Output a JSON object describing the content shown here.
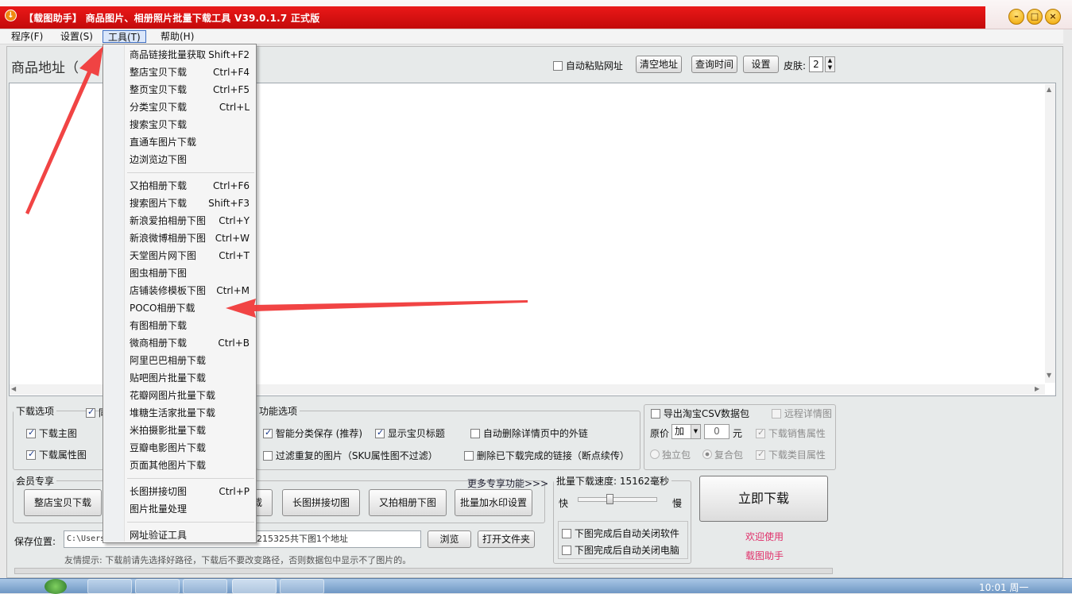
{
  "window": {
    "title": "【载图助手】 商品图片、相册照片批量下载工具 V39.0.1.7 正式版"
  },
  "menubar": [
    "程序(F)",
    "设置(S)",
    "工具(T)",
    "帮助(H)"
  ],
  "top": {
    "goods_label": "商品地址（",
    "auto_paste": "自动粘贴网址",
    "clear": "清空地址",
    "query_time": "查询时间",
    "settings": "设置",
    "skin_label": "皮肤:",
    "skin_value": "2"
  },
  "dropdown": {
    "group1": [
      {
        "label": "商品链接批量获取",
        "shortcut": "Shift+F2"
      },
      {
        "label": "整店宝贝下载",
        "shortcut": "Ctrl+F4"
      },
      {
        "label": "整页宝贝下载",
        "shortcut": "Ctrl+F5"
      },
      {
        "label": "分类宝贝下载",
        "shortcut": "Ctrl+L"
      },
      {
        "label": "搜索宝贝下载",
        "shortcut": ""
      },
      {
        "label": "直通车图片下载",
        "shortcut": ""
      },
      {
        "label": "边浏览边下图",
        "shortcut": ""
      }
    ],
    "group2": [
      {
        "label": "又拍相册下载",
        "shortcut": "Ctrl+F6"
      },
      {
        "label": "搜索图片下载",
        "shortcut": "Shift+F3"
      },
      {
        "label": "新浪爱拍相册下图",
        "shortcut": "Ctrl+Y"
      },
      {
        "label": "新浪微博相册下图",
        "shortcut": "Ctrl+W"
      },
      {
        "label": "天堂图片网下图",
        "shortcut": "Ctrl+T"
      },
      {
        "label": "图虫相册下图",
        "shortcut": ""
      },
      {
        "label": "店铺装修模板下图",
        "shortcut": "Ctrl+M"
      },
      {
        "label": "POCO相册下载",
        "shortcut": ""
      },
      {
        "label": "有图相册下载",
        "shortcut": ""
      },
      {
        "label": "微商相册下载",
        "shortcut": "Ctrl+B"
      },
      {
        "label": "阿里巴巴相册下载",
        "shortcut": ""
      },
      {
        "label": "贴吧图片批量下载",
        "shortcut": ""
      },
      {
        "label": "花瓣网图片批量下载",
        "shortcut": ""
      },
      {
        "label": "堆糖生活家批量下载",
        "shortcut": ""
      },
      {
        "label": "米拍摄影批量下载",
        "shortcut": ""
      },
      {
        "label": "豆瓣电影图片下载",
        "shortcut": ""
      },
      {
        "label": "页面其他图片下载",
        "shortcut": ""
      }
    ],
    "group3": [
      {
        "label": "长图拼接切图",
        "shortcut": "Ctrl+P"
      },
      {
        "label": "图片批量处理",
        "shortcut": ""
      }
    ],
    "group4": [
      {
        "label": "网址验证工具",
        "shortcut": ""
      }
    ]
  },
  "download_options": {
    "legend": "下载选项",
    "partial_top": "同",
    "main_image": "下载主图",
    "attr_image": "下载属性图"
  },
  "function_options": {
    "legend": "功能选项",
    "smart_save": "智能分类保存 (推荐)",
    "show_title": "显示宝贝标题",
    "auto_delete_links": "自动删除详情页中的外链",
    "filter_dup": "过滤重复的图片（SKU属性图不过滤）",
    "delete_done": "删除已下载完成的链接（断点续传）"
  },
  "taobao": {
    "export_csv": "导出淘宝CSV数据包",
    "remote_detail": "远程详情图",
    "price_label": "原价",
    "op_value": "加",
    "amount_value": "0",
    "unit": "元",
    "sales_attr": "下载销售属性",
    "single_pkg": "独立包",
    "combined_pkg": "复合包",
    "category_attr": "下载类目属性"
  },
  "member": {
    "legend": "会员专享",
    "more": "更多专享功能>>>",
    "buttons": [
      "整店宝贝下载",
      "载",
      "长图拼接切图",
      "又拍相册下图",
      "批量加水印设置"
    ]
  },
  "speed": {
    "legend": "批量下载速度: 15162毫秒",
    "fast": "快",
    "slow": "慢",
    "slider_fraction": 0.4,
    "close_software": "下图完成后自动关闭软件",
    "close_computer": "下图完成后自动关闭电脑"
  },
  "download_now": "立即下载",
  "welcome": [
    "欢迎使用",
    "载图助手"
  ],
  "save": {
    "label": "保存位置:",
    "path_start": "C:\\Users",
    "path_end": "215325共下图1个地址",
    "browse": "浏览",
    "open_folder": "打开文件夹",
    "tip": "友情提示: 下载前请先选择好路径，下载后不要改变路径，否则数据包中显示不了图片的。"
  },
  "taskbar": {
    "time": "10:01 周一"
  },
  "colors": {
    "title_red": "#d41010",
    "arrow_red": "#f03a3a",
    "welcome_pink": "#e0306a"
  }
}
